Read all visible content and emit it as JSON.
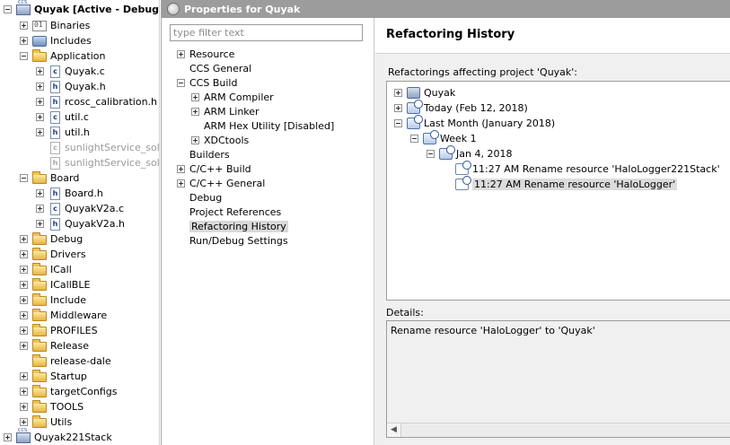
{
  "project_tree": {
    "items": [
      {
        "label": "Quyak  [Active - Debug]",
        "depth": 0,
        "toggle": "minus",
        "icon": "project-icon",
        "bold": true
      },
      {
        "label": "Binaries",
        "depth": 1,
        "toggle": "plus",
        "icon": "binaries-icon"
      },
      {
        "label": "Includes",
        "depth": 1,
        "toggle": "plus",
        "icon": "includes-icon"
      },
      {
        "label": "Application",
        "depth": 1,
        "toggle": "minus",
        "icon": "folder-icon"
      },
      {
        "label": "Quyak.c",
        "depth": 2,
        "toggle": "plus",
        "icon": "c-file-icon",
        "glyph": "c"
      },
      {
        "label": "Quyak.h",
        "depth": 2,
        "toggle": "plus",
        "icon": "h-file-icon",
        "glyph": "h"
      },
      {
        "label": "rcosc_calibration.h",
        "depth": 2,
        "toggle": "plus",
        "icon": "h-file-icon",
        "glyph": "h"
      },
      {
        "label": "util.c",
        "depth": 2,
        "toggle": "plus",
        "icon": "c-file-icon",
        "glyph": "c"
      },
      {
        "label": "util.h",
        "depth": 2,
        "toggle": "plus",
        "icon": "h-file-icon",
        "glyph": "h"
      },
      {
        "label": "sunlightService_soln.",
        "depth": 2,
        "toggle": "none",
        "icon": "excluded-file-icon",
        "glyph": "c",
        "dim": true
      },
      {
        "label": "sunlightService_soln.",
        "depth": 2,
        "toggle": "none",
        "icon": "excluded-file-icon",
        "glyph": "h",
        "dim": true
      },
      {
        "label": "Board",
        "depth": 1,
        "toggle": "minus",
        "icon": "folder-icon"
      },
      {
        "label": "Board.h",
        "depth": 2,
        "toggle": "plus",
        "icon": "h-file-icon",
        "glyph": "h"
      },
      {
        "label": "QuyakV2a.c",
        "depth": 2,
        "toggle": "plus",
        "icon": "c-file-icon",
        "glyph": "c"
      },
      {
        "label": "QuyakV2a.h",
        "depth": 2,
        "toggle": "plus",
        "icon": "h-file-icon",
        "glyph": "h"
      },
      {
        "label": "Debug",
        "depth": 1,
        "toggle": "plus",
        "icon": "folder-icon"
      },
      {
        "label": "Drivers",
        "depth": 1,
        "toggle": "plus",
        "icon": "folder-icon"
      },
      {
        "label": "ICall",
        "depth": 1,
        "toggle": "plus",
        "icon": "folder-icon"
      },
      {
        "label": "ICallBLE",
        "depth": 1,
        "toggle": "plus",
        "icon": "folder-icon"
      },
      {
        "label": "Include",
        "depth": 1,
        "toggle": "plus",
        "icon": "folder-icon"
      },
      {
        "label": "Middleware",
        "depth": 1,
        "toggle": "plus",
        "icon": "folder-icon"
      },
      {
        "label": "PROFILES",
        "depth": 1,
        "toggle": "plus",
        "icon": "folder-icon"
      },
      {
        "label": "Release",
        "depth": 1,
        "toggle": "plus",
        "icon": "folder-icon"
      },
      {
        "label": "release-dale",
        "depth": 1,
        "toggle": "none",
        "icon": "folder-icon"
      },
      {
        "label": "Startup",
        "depth": 1,
        "toggle": "plus",
        "icon": "folder-icon"
      },
      {
        "label": "targetConfigs",
        "depth": 1,
        "toggle": "plus",
        "icon": "folder-icon"
      },
      {
        "label": "TOOLS",
        "depth": 1,
        "toggle": "plus",
        "icon": "folder-icon"
      },
      {
        "label": "Utils",
        "depth": 1,
        "toggle": "plus",
        "icon": "folder-icon"
      },
      {
        "label": "Quyak221Stack",
        "depth": 0,
        "toggle": "plus",
        "icon": "project-icon"
      }
    ]
  },
  "dialog": {
    "title": "Properties for Quyak",
    "filter_placeholder": "type filter text",
    "nav": [
      {
        "label": "Resource",
        "depth": 0,
        "toggle": "plus"
      },
      {
        "label": "CCS General",
        "depth": 0,
        "toggle": "none"
      },
      {
        "label": "CCS Build",
        "depth": 0,
        "toggle": "minus"
      },
      {
        "label": "ARM Compiler",
        "depth": 1,
        "toggle": "plus"
      },
      {
        "label": "ARM Linker",
        "depth": 1,
        "toggle": "plus"
      },
      {
        "label": "ARM Hex Utility  [Disabled]",
        "depth": 1,
        "toggle": "none"
      },
      {
        "label": "XDCtools",
        "depth": 1,
        "toggle": "plus"
      },
      {
        "label": "Builders",
        "depth": 0,
        "toggle": "none"
      },
      {
        "label": "C/C++ Build",
        "depth": 0,
        "toggle": "plus"
      },
      {
        "label": "C/C++ General",
        "depth": 0,
        "toggle": "plus"
      },
      {
        "label": "Debug",
        "depth": 0,
        "toggle": "none"
      },
      {
        "label": "Project References",
        "depth": 0,
        "toggle": "none"
      },
      {
        "label": "Refactoring History",
        "depth": 0,
        "toggle": "none",
        "selected": true
      },
      {
        "label": "Run/Debug Settings",
        "depth": 0,
        "toggle": "none"
      }
    ],
    "page": {
      "title": "Refactoring History",
      "affecting_label": "Refactorings affecting project 'Quyak':",
      "history": [
        {
          "label": "Quyak",
          "depth": 0,
          "toggle": "plus",
          "icon": "project-icon"
        },
        {
          "label": "Today (Feb 12, 2018)",
          "depth": 0,
          "toggle": "plus",
          "icon": "history-group-icon"
        },
        {
          "label": "Last Month (January 2018)",
          "depth": 0,
          "toggle": "minus",
          "icon": "history-group-icon"
        },
        {
          "label": "Week 1",
          "depth": 1,
          "toggle": "minus",
          "icon": "history-group-icon"
        },
        {
          "label": "Jan 4, 2018",
          "depth": 2,
          "toggle": "minus",
          "icon": "history-group-icon"
        },
        {
          "label": "11:27 AM Rename resource 'HaloLogger221Stack'",
          "depth": 3,
          "toggle": "none",
          "icon": "refactoring-item-icon"
        },
        {
          "label": "11:27 AM Rename resource 'HaloLogger'",
          "depth": 3,
          "toggle": "none",
          "icon": "refactoring-item-icon",
          "selected": true
        }
      ],
      "details_label": "Details:",
      "details_text": "Rename resource 'HaloLogger' to 'Quyak'"
    }
  }
}
